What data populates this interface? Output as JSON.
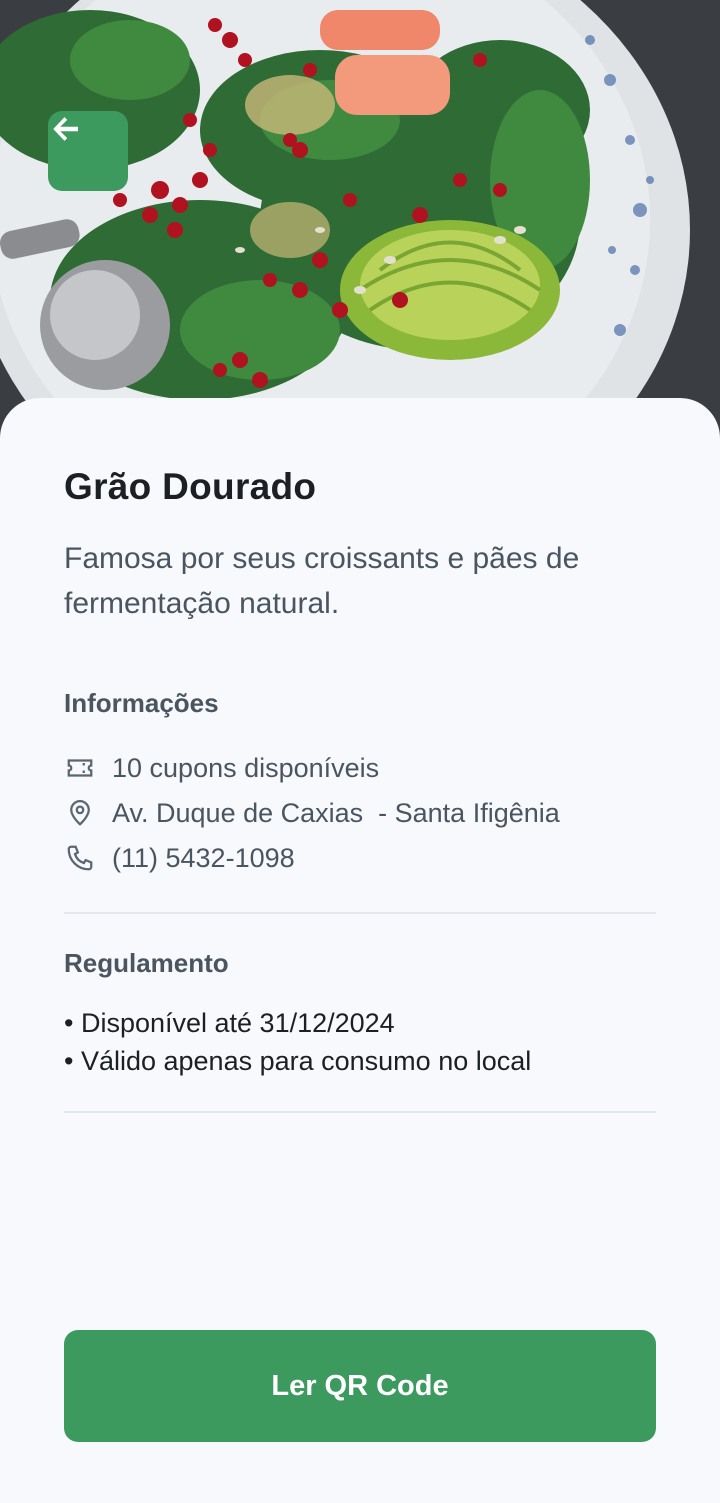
{
  "hero": {
    "image": "salad-bowl-photo",
    "back_icon": "arrow-left-icon",
    "accent_color": "#3d9a5f"
  },
  "store": {
    "name": "Grão Dourado",
    "description": "Famosa por seus croissants e pães de fermentação natural."
  },
  "info": {
    "heading": "Informações",
    "items": [
      {
        "icon": "ticket-icon",
        "text": "10 cupons disponíveis"
      },
      {
        "icon": "map-pin-icon",
        "text": "Av. Duque de Caxias  - Santa Ifigênia"
      },
      {
        "icon": "phone-icon",
        "text": "(11) 5432-1098"
      }
    ]
  },
  "rules": {
    "heading": "Regulamento",
    "lines": [
      "• Disponível até 31/12/2024",
      "• Válido apenas para consumo no local"
    ]
  },
  "cta": {
    "label": "Ler QR Code",
    "color": "#3d9a5f"
  }
}
